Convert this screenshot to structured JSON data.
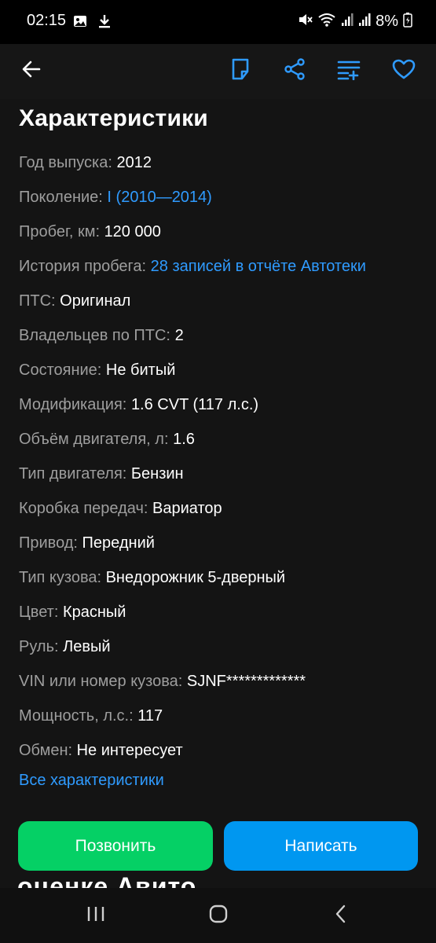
{
  "status_bar": {
    "time": "02:15",
    "battery": "8%"
  },
  "toolbar": {
    "icons": [
      "arrow-left-icon",
      "note-icon",
      "share-icon",
      "compare-icon",
      "heart-icon"
    ],
    "accent_color": "#2f9bff"
  },
  "section": {
    "title": "Характеристики"
  },
  "specs": [
    {
      "label": "Год выпуска:",
      "value": "2012",
      "link": false
    },
    {
      "label": "Поколение:",
      "value": "I (2010—2014)",
      "link": true
    },
    {
      "label": "Пробег, км:",
      "value": "120 000",
      "link": false
    },
    {
      "label": "История пробега:",
      "value": "28 записей в отчёте Автотеки",
      "link": true
    },
    {
      "label": "ПТС:",
      "value": "Оригинал",
      "link": false
    },
    {
      "label": "Владельцев по ПТС:",
      "value": "2",
      "link": false
    },
    {
      "label": "Состояние:",
      "value": "Не битый",
      "link": false
    },
    {
      "label": "Модификация:",
      "value": "1.6 CVT (117 л.с.)",
      "link": false
    },
    {
      "label": "Объём двигателя, л:",
      "value": "1.6",
      "link": false
    },
    {
      "label": "Тип двигателя:",
      "value": "Бензин",
      "link": false
    },
    {
      "label": "Коробка передач:",
      "value": "Вариатор",
      "link": false
    },
    {
      "label": "Привод:",
      "value": "Передний",
      "link": false
    },
    {
      "label": "Тип кузова:",
      "value": "Внедорожник 5-дверный",
      "link": false
    },
    {
      "label": "Цвет:",
      "value": "Красный",
      "link": false
    },
    {
      "label": "Руль:",
      "value": "Левый",
      "link": false
    },
    {
      "label": "VIN или номер кузова:",
      "value": "SJNF*************",
      "link": false
    },
    {
      "label": "Мощность, л.с.:",
      "value": "117",
      "link": false
    },
    {
      "label": "Обмен:",
      "value": "Не интересует",
      "link": false
    }
  ],
  "all_specs_link": "Все характеристики",
  "next_section_heading": "оценке Авито",
  "actions": {
    "call_label": "Позвонить",
    "write_label": "Написать",
    "call_color": "#05d065",
    "write_color": "#0097f0"
  },
  "nav_bar": {
    "icons": [
      "recent-apps-icon",
      "home-icon",
      "back-icon"
    ]
  }
}
